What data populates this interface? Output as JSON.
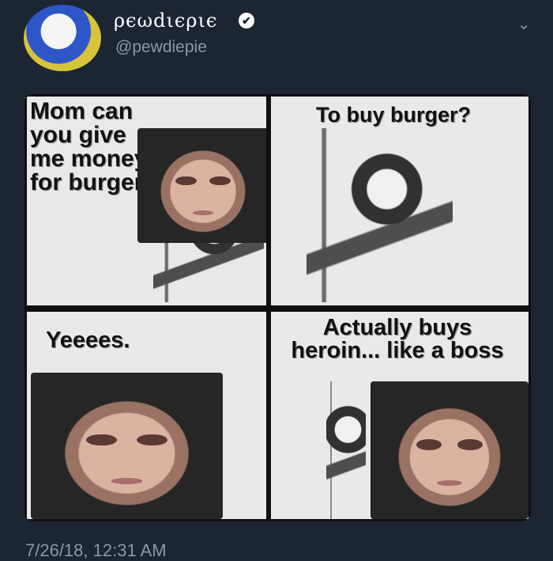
{
  "tweet": {
    "display_name": "ρєωdιєριє",
    "handle": "@pewdiepie",
    "verified_icon": "✔",
    "chevron_icon": "⌄",
    "timestamp": "7/26/18, 12:31 AM"
  },
  "meme": {
    "panel1_text": "Mom can you give me money for burger",
    "panel2_text": "To buy burger?",
    "panel3_text": "Yeeees.",
    "panel4_text": "Actually buys heroin... like a boss"
  }
}
